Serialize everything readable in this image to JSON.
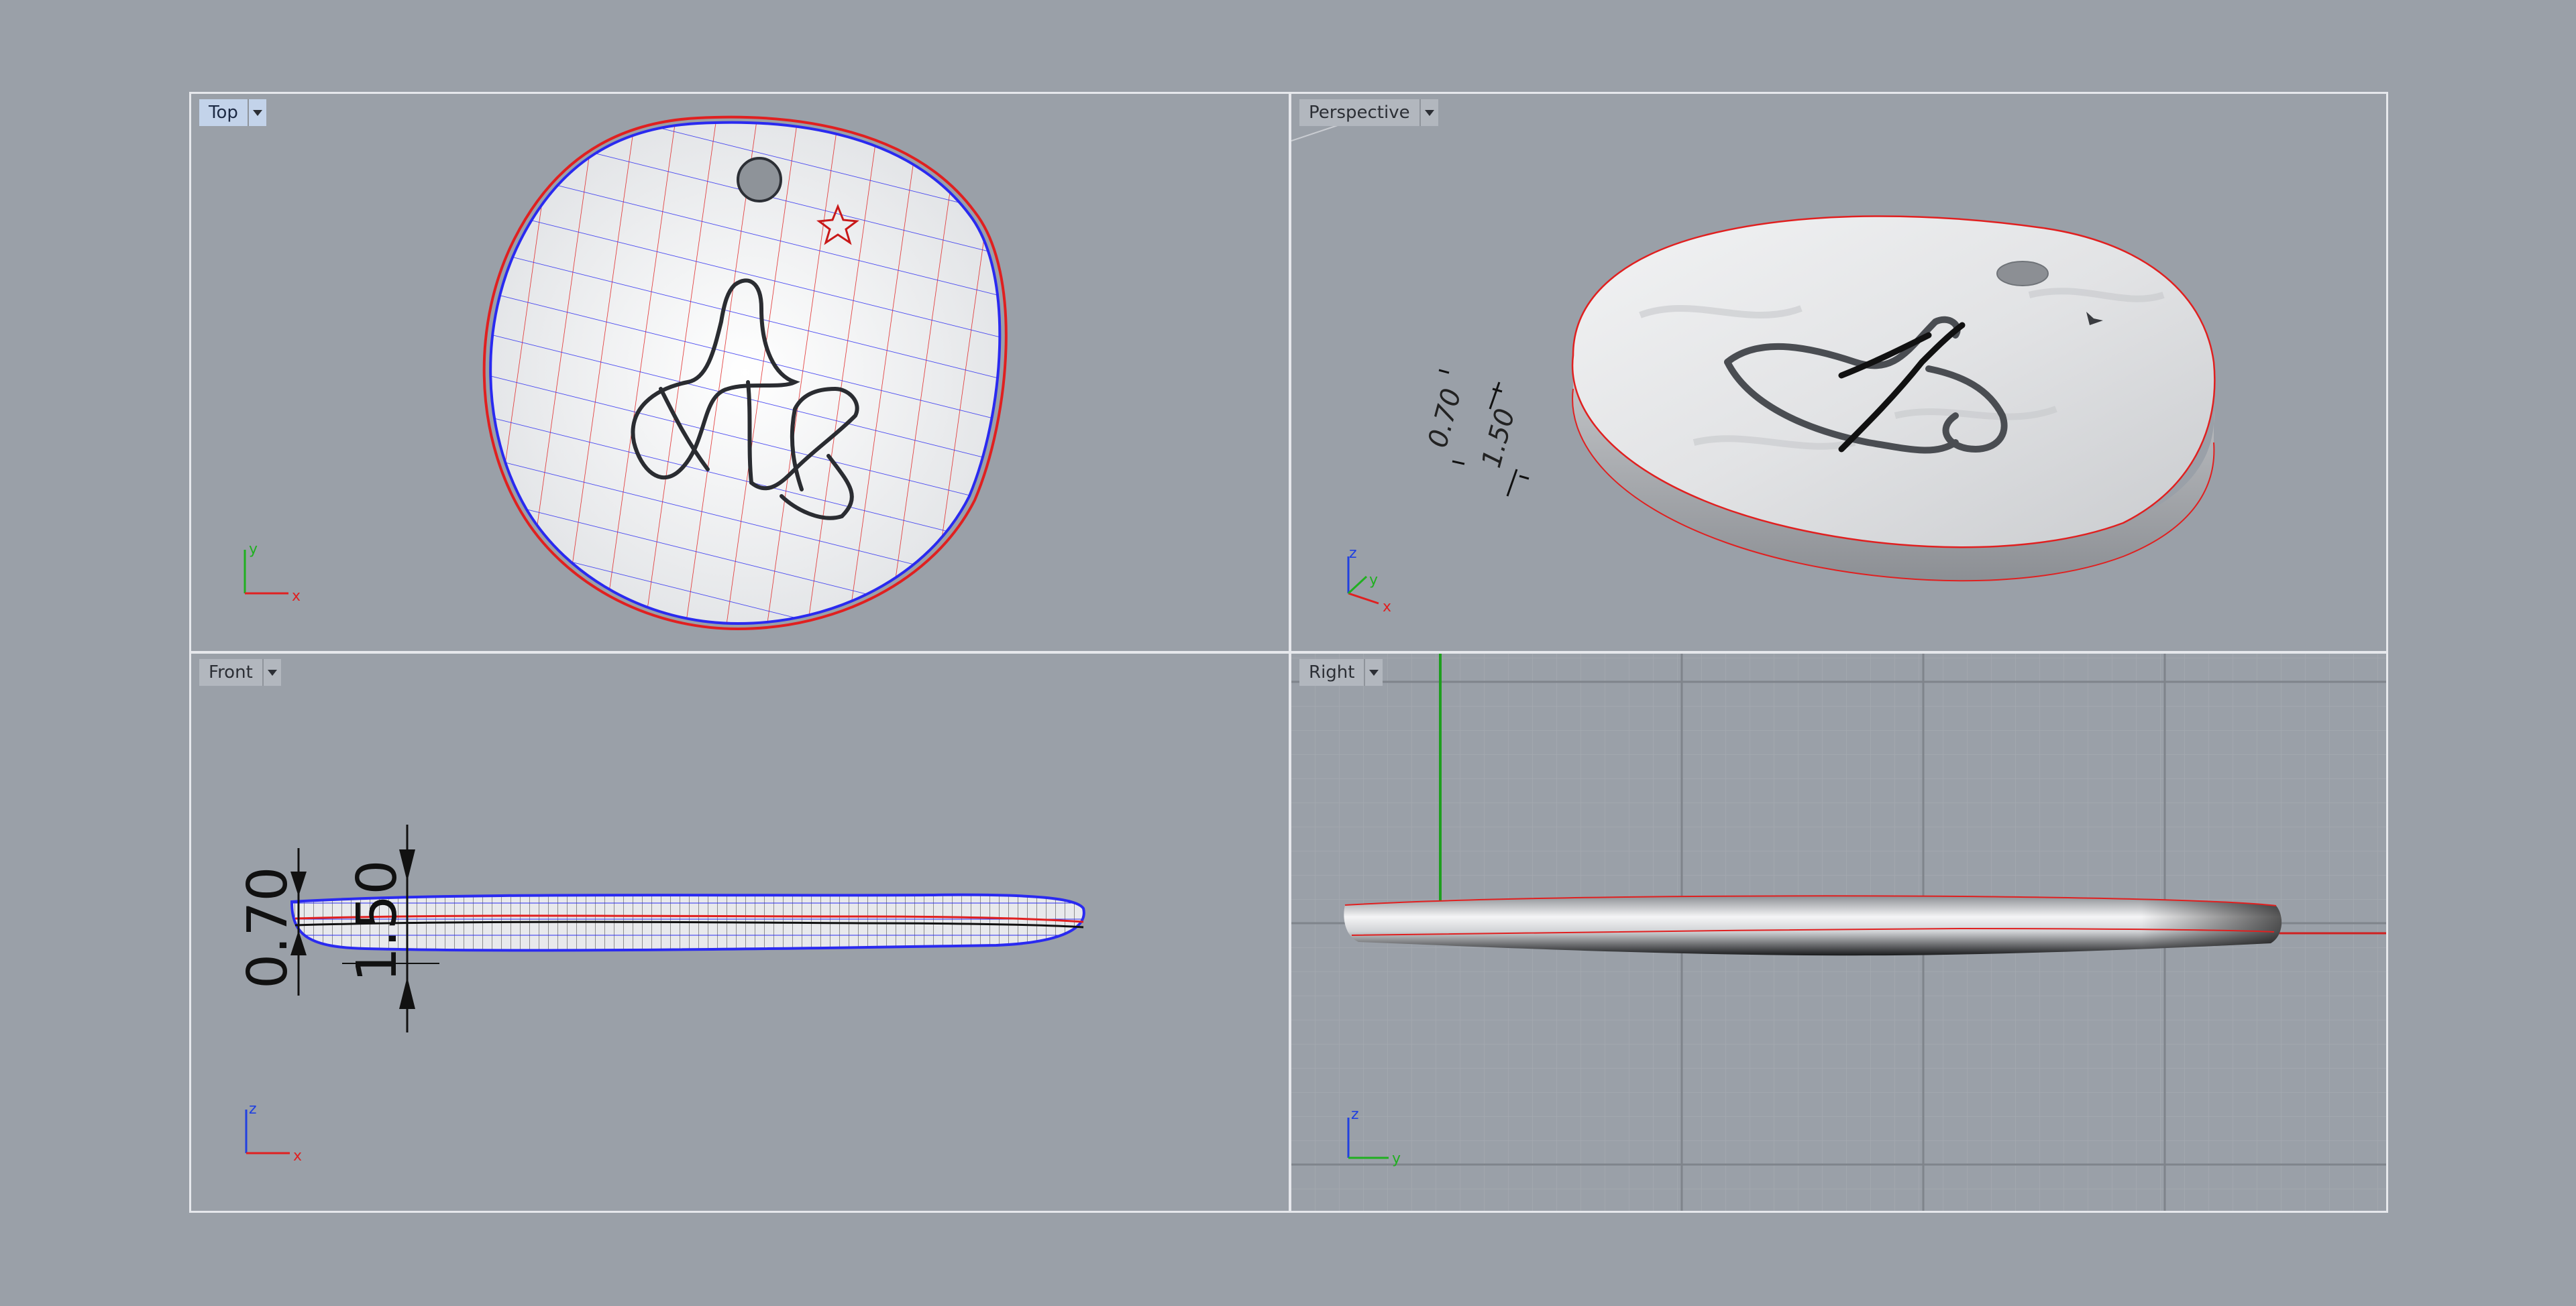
{
  "viewports": {
    "top": {
      "label": "Top"
    },
    "perspective": {
      "label": "Perspective"
    },
    "front": {
      "label": "Front"
    },
    "right": {
      "label": "Right"
    }
  },
  "dimensions": {
    "inner": "0.70",
    "outer": "1.50"
  },
  "axes": {
    "x": "x",
    "y": "y",
    "z": "z"
  },
  "icons": {
    "viewport_menu": "chevron-down-icon"
  },
  "colors": {
    "background": "#9aa0a8",
    "frame": "#e6e8ec",
    "active_tab": "#c3d3ea",
    "curve_red": "#e02020",
    "curve_blue": "#2a2af0",
    "axis_red": "#e02020",
    "axis_green": "#20b020",
    "axis_blue": "#2040e0"
  }
}
